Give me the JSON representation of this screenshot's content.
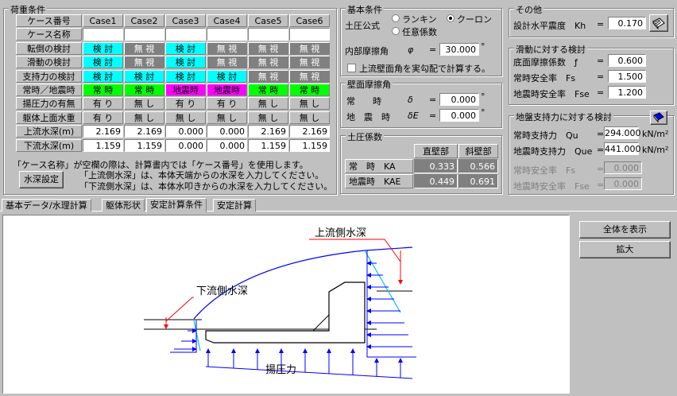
{
  "load": {
    "title": "荷重条件",
    "header_label": "ケース番号",
    "cases": [
      "Case1",
      "Case2",
      "Case3",
      "Case4",
      "Case5",
      "Case6"
    ],
    "rows": [
      {
        "label": "ケース名称",
        "values": [
          "",
          "",
          "",
          "",
          "",
          ""
        ],
        "colors": [
          "#ffffff",
          "#ffffff",
          "#ffffff",
          "#ffffff",
          "#ffffff",
          "#ffffff"
        ]
      },
      {
        "label": "転倒の検討",
        "values": [
          "検 討",
          "無 視",
          "検 討",
          "無 視",
          "無 視",
          "無 視"
        ],
        "colors": [
          "#00ffff",
          "#808080",
          "#00ffff",
          "#808080",
          "#808080",
          "#808080"
        ]
      },
      {
        "label": "滑動の検討",
        "values": [
          "検 討",
          "無 視",
          "検 討",
          "無 視",
          "無 視",
          "無 視"
        ],
        "colors": [
          "#00ffff",
          "#808080",
          "#00ffff",
          "#808080",
          "#808080",
          "#808080"
        ]
      },
      {
        "label": "支持力の検討",
        "values": [
          "検 討",
          "検 討",
          "検 討",
          "検 討",
          "無 視",
          "無 視"
        ],
        "colors": [
          "#00ffff",
          "#00ffff",
          "#00ffff",
          "#00ffff",
          "#808080",
          "#808080"
        ]
      },
      {
        "label": "常時／地震時",
        "values": [
          "常 時",
          "常 時",
          "地震時",
          "地震時",
          "常 時",
          "常 時"
        ],
        "colors": [
          "#00ff00",
          "#00ff00",
          "#ff00ff",
          "#ff00ff",
          "#00ff00",
          "#00ff00"
        ]
      },
      {
        "label": "揚圧力の有無",
        "values": [
          "有 り",
          "無 し",
          "有 り",
          "有 り",
          "無 し",
          "無 し"
        ],
        "colors": [
          "#c0c0c0",
          "#c0c0c0",
          "#c0c0c0",
          "#c0c0c0",
          "#c0c0c0",
          "#c0c0c0"
        ]
      },
      {
        "label": "躯体上面水重",
        "values": [
          "有 り",
          "無 し",
          "無 し",
          "無 し",
          "無 し",
          "無 し"
        ],
        "colors": [
          "#c0c0c0",
          "#c0c0c0",
          "#c0c0c0",
          "#c0c0c0",
          "#c0c0c0",
          "#c0c0c0"
        ]
      },
      {
        "label": "上流水深(m)",
        "values": [
          "2.169",
          "2.169",
          "0.000",
          "0.000",
          "2.169",
          "2.169"
        ],
        "colors": [
          "#ffffff",
          "#ffffff",
          "#ffffff",
          "#ffffff",
          "#ffffff",
          "#ffffff"
        ]
      },
      {
        "label": "下流水深(m)",
        "values": [
          "1.159",
          "1.159",
          "0.000",
          "0.000",
          "1.159",
          "1.159"
        ],
        "colors": [
          "#ffffff",
          "#ffffff",
          "#ffffff",
          "#ffffff",
          "#ffffff",
          "#ffffff"
        ]
      }
    ],
    "note1": "「ケース名称」が空欄の際は、計算書内では「ケース番号」を使用します。",
    "note2": "「上流側水深」は、本体天端からの水深を入力してください。",
    "note3": "「下流側水深」は、本体水叩きからの水深を入力してください。",
    "btn_water": "水深設定"
  },
  "basic": {
    "title": "基本条件",
    "earth_label": "土圧公式",
    "opt_rankine": "ランキン",
    "opt_coulomb": "クーロン",
    "opt_any": "任意係数",
    "phi_label": "内部摩擦角",
    "phi_sym": "φ",
    "phi_value": "30.000",
    "deg": "°",
    "chk_label": "上流壁面角を実勾配で計算する。"
  },
  "wall": {
    "title": "壁面摩擦角",
    "normal": "常　　時",
    "sym1": "δ",
    "val1": "0.000",
    "quake": "地　震　時",
    "sym2": "δE",
    "val2": "0.000",
    "deg": "°"
  },
  "coef": {
    "title": "土圧係数",
    "col1": "直壁部",
    "col2": "斜壁部",
    "r1": "常　時　KA",
    "r1v1": "0.333",
    "r1v2": "0.566",
    "r2": "地震時　KAE",
    "r2v1": "0.449",
    "r2v2": "0.691"
  },
  "other": {
    "title": "その他",
    "kh_label": "設計水平震度　Kh",
    "kh_value": "0.170"
  },
  "slide": {
    "title": "滑動に対する検討",
    "f_label": "底面摩擦係数　ƒ",
    "f_value": "0.600",
    "fs_label": "常時安全率　Fs",
    "fs_value": "1.500",
    "fse_label": "地震時安全率　Fse",
    "fse_value": "1.200"
  },
  "bearing": {
    "title": "地盤支持力に対する検討",
    "qu_label": "常時支持力　Qu",
    "qu_value": "294.000",
    "que_label": "地震時支持力　Que",
    "que_value": "441.000",
    "unit": "kN/m²",
    "fs_label": "常時安全率　Fs",
    "fs_value": "0.000",
    "fse_label": "地震時安全率　Fse",
    "fse_value": "0.000"
  },
  "tabs": [
    "基本データ/水理計算",
    "躯体形状",
    "安定計算条件",
    "安定計算"
  ],
  "diagram": {
    "up_label": "上流側水深",
    "down_label": "下流側水深",
    "uplift_label": "揚圧力"
  },
  "buttons": {
    "show_all": "全体を表示",
    "zoom": "拡大"
  },
  "equals": "="
}
